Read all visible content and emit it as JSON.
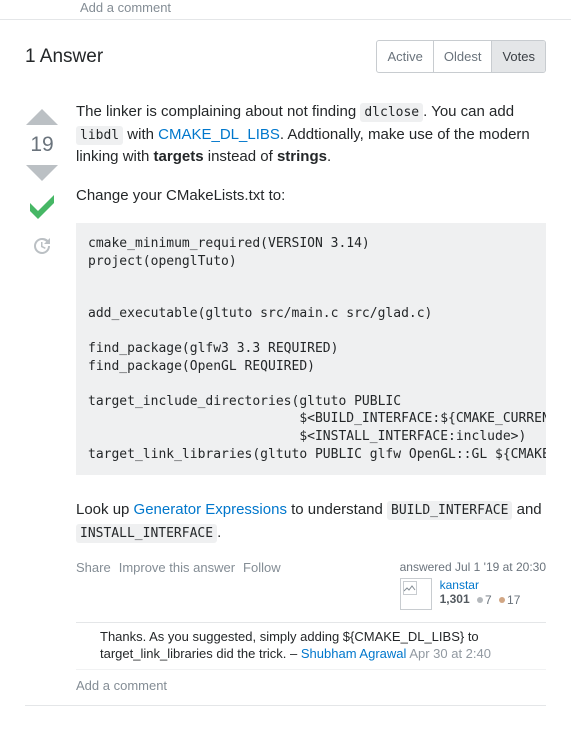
{
  "top_add_comment": "Add a comment",
  "answers_count_label": "1 Answer",
  "tabs": {
    "active": "Active",
    "oldest": "Oldest",
    "votes": "Votes"
  },
  "vote_count": "19",
  "prose": {
    "p1a": "The linker is complaining about not finding ",
    "p1_code1": "dlclose",
    "p1b": ". You can add ",
    "p1_code2": "libdl",
    "p1c": " with ",
    "p1_link": "CMAKE_DL_LIBS",
    "p1d": ". Addtionally, make use of the modern linking with ",
    "p1_bold1": "targets",
    "p1e": " instead of ",
    "p1_bold2": "strings",
    "p1f": ".",
    "p2": "Change your CMakeLists.txt to:",
    "code": "cmake_minimum_required(VERSION 3.14)\nproject(openglTuto)\n\n\nadd_executable(gltuto src/main.c src/glad.c)\n\nfind_package(glfw3 3.3 REQUIRED)\nfind_package(OpenGL REQUIRED)\n\ntarget_include_directories(gltuto PUBLIC\n                           $<BUILD_INTERFACE:${CMAKE_CURRENT_SOURCE_DIR}/include>\n                           $<INSTALL_INTERFACE:include>)\ntarget_link_libraries(gltuto PUBLIC glfw OpenGL::GL ${CMAKE_DL_LIBS})",
    "p3a": "Look up ",
    "p3_link": "Generator Expressions",
    "p3b": " to understand ",
    "p3_code1": "BUILD_INTERFACE",
    "p3c": " and ",
    "p3_code2": "INSTALL_INTERFACE",
    "p3d": "."
  },
  "menu": {
    "share": "Share",
    "improve": "Improve this answer",
    "follow": "Follow"
  },
  "user": {
    "action": "answered Jul 1 '19 at 20:30",
    "name": "kanstar",
    "rep": "1,301",
    "silver": "7",
    "bronze": "17"
  },
  "comment": {
    "text": "Thanks. As you suggested, simply adding ${CMAKE_DL_LIBS} to target_link_libraries did the trick.",
    "author": "Shubham Agrawal",
    "time": "Apr 30 at 2:40"
  },
  "add_comment": "Add a comment"
}
